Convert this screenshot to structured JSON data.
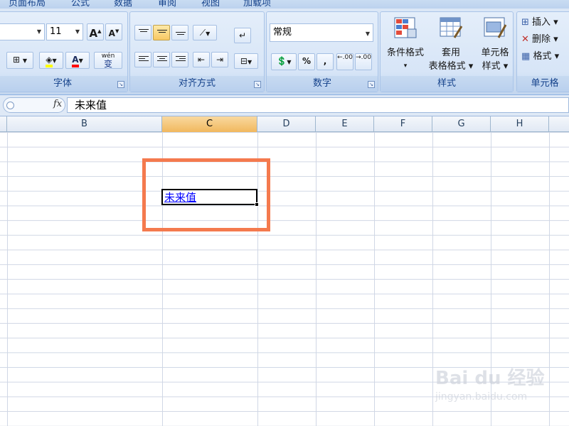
{
  "ribbon_tabs": [
    "页面布局",
    "公式",
    "数据",
    "审阅",
    "视图",
    "加载项"
  ],
  "font_group": {
    "label": "字体",
    "font_size": "11",
    "grow_font": "A",
    "shrink_font": "A",
    "font_color_letter": "A",
    "phonetic_letter": "wén",
    "phonetic_char": "变"
  },
  "alignment_group": {
    "label": "对齐方式"
  },
  "number_group": {
    "label": "数字",
    "format_value": "常规",
    "percent": "%",
    "comma": ",",
    "inc_decimal": ".00",
    "dec_decimal": ".00"
  },
  "styles_group": {
    "label": "样式",
    "conditional_format": [
      "条件格式",
      "▾"
    ],
    "table_format": [
      "套用",
      "表格格式 ▾"
    ],
    "cell_styles": [
      "单元格",
      "样式 ▾"
    ]
  },
  "cells_group": {
    "label": "单元格",
    "insert": "插入 ▾",
    "delete": "删除 ▾",
    "format": "格式 ▾"
  },
  "formula_bar": {
    "fx_label": "fx",
    "content": "未来值"
  },
  "columns": [
    "B",
    "C",
    "D",
    "E",
    "F",
    "G",
    "H"
  ],
  "selected_column": "C",
  "active_cell": {
    "value": "未来值"
  },
  "watermark": {
    "title": "Bai du 经验",
    "url": "jingyan.baidu.com"
  },
  "colors": {
    "highlight_border": "#f47a4e",
    "link": "#0000ff",
    "selected_header": "#f1b85e"
  }
}
